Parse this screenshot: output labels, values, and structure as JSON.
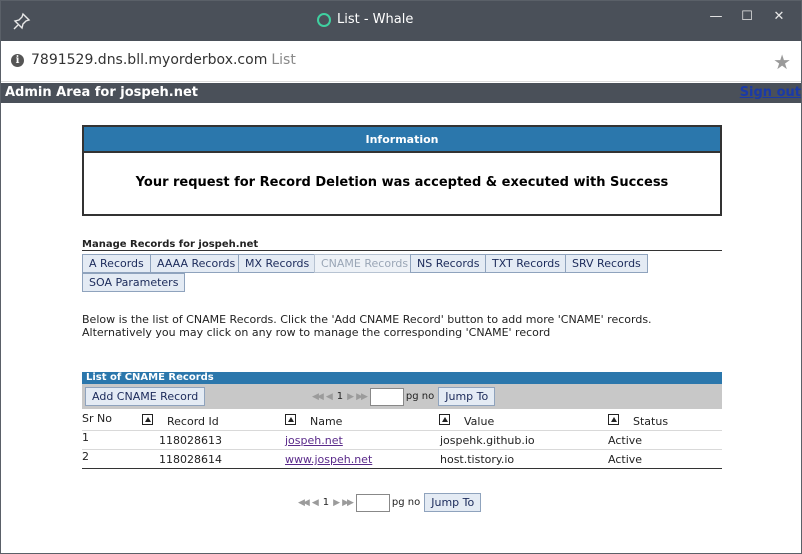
{
  "window": {
    "title": "List - Whale",
    "controls": {
      "minimize": "—",
      "maximize": "☐",
      "close": "✕"
    }
  },
  "address": {
    "url": "7891529.dns.bll.myorderbox.com",
    "page_title": "List"
  },
  "admin": {
    "title": "Admin Area for jospeh.net",
    "signout": "Sign out"
  },
  "info": {
    "header": "Information",
    "message": "Your request for Record Deletion was accepted & executed with Success"
  },
  "manage": {
    "label": "Manage Records for jospeh.net",
    "buttons": [
      {
        "label": "A Records"
      },
      {
        "label": "AAAA Records"
      },
      {
        "label": "MX Records"
      },
      {
        "label": "CNAME Records"
      },
      {
        "label": "NS Records"
      },
      {
        "label": "TXT Records"
      },
      {
        "label": "SRV Records"
      },
      {
        "label": "SOA Parameters"
      }
    ]
  },
  "description": "Below is the list of CNAME Records. Click the 'Add CNAME Record' button to add more 'CNAME' records. Alternatively you may click on any row to manage the corresponding 'CNAME' record",
  "list": {
    "header": "List of CNAME Records",
    "add_button": "Add CNAME Record",
    "pager": {
      "page": "1",
      "pg_no": "pg no",
      "jump": "Jump To"
    },
    "columns": [
      "Sr No",
      "Record Id",
      "Name",
      "Value",
      "Status"
    ],
    "rows": [
      {
        "sr": "1",
        "id": "118028613",
        "name": "jospeh.net",
        "value": "jospehk.github.io",
        "status": "Active"
      },
      {
        "sr": "2",
        "id": "118028614",
        "name": "www.jospeh.net",
        "value": "host.tistory.io",
        "status": "Active"
      }
    ]
  },
  "colors": {
    "titlebar": "#4a5059",
    "accent_blue": "#2b77ac",
    "link": "#1a3aa8",
    "whale_green": "#3fd0a0"
  }
}
